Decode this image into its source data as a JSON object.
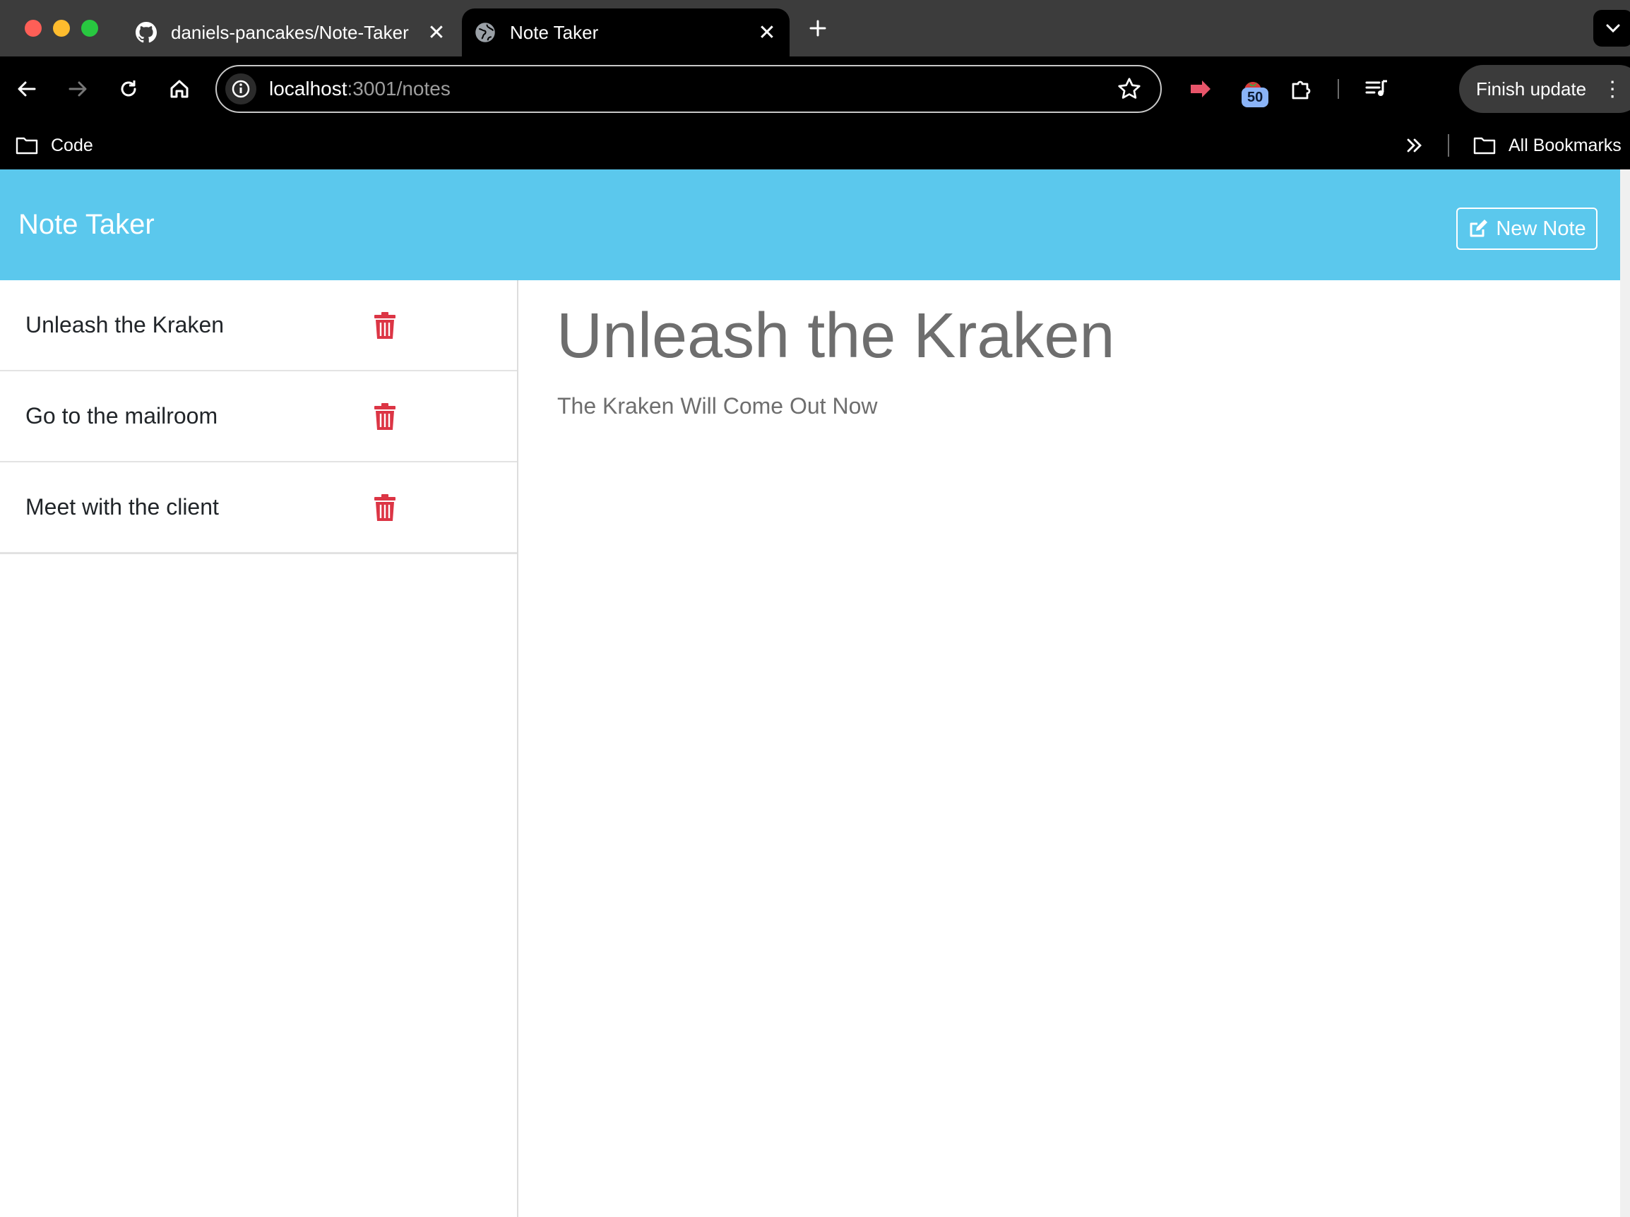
{
  "browser": {
    "tabs": [
      {
        "title": "daniels-pancakes/Note-Taker",
        "icon": "github-icon",
        "active": false
      },
      {
        "title": "Note Taker",
        "icon": "globe-icon",
        "active": true
      }
    ],
    "url_host": "localhost",
    "url_rest": ":3001/notes",
    "extension_badge": "50",
    "finish_update_label": "Finish update",
    "bookmarks": {
      "code_label": "Code",
      "all_bookmarks_label": "All Bookmarks"
    }
  },
  "app": {
    "brand": "Note Taker",
    "new_note_label": "New Note",
    "notes": [
      {
        "title": "Unleash the Kraken"
      },
      {
        "title": "Go to the mailroom"
      },
      {
        "title": "Meet with the client"
      }
    ],
    "active_note": {
      "title": "Unleash the Kraken",
      "text": "The Kraken Will Come Out Now"
    }
  },
  "colors": {
    "header": "#5bc8ed",
    "trash": "#dc3545",
    "text_muted": "#6e6e6e"
  }
}
